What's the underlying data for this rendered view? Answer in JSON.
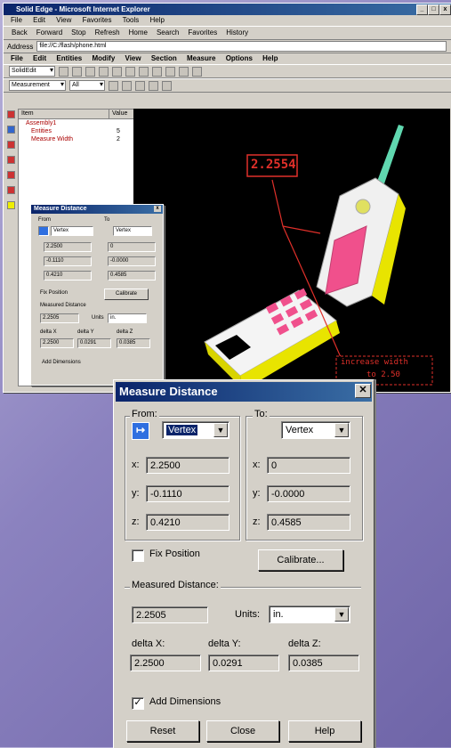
{
  "app": {
    "title": "Solid Edge - Microsoft Internet Explorer",
    "browser_menu": [
      "File",
      "Edit",
      "View",
      "Favorites",
      "Tools",
      "Help"
    ],
    "browser_toolbar": [
      "Back",
      "Forward",
      "Stop",
      "Refresh",
      "Home",
      "Search",
      "Favorites",
      "History"
    ],
    "address_label": "Address",
    "address_value": "file://C:/flash/phone.html",
    "app_menu": [
      "File",
      "Edit",
      "Entities",
      "Modify",
      "View",
      "Section",
      "Measure",
      "Options",
      "Help"
    ],
    "combo1": "SolidEdit",
    "combo2": "Measurement",
    "combo3": "All",
    "tree_headers": [
      "Item",
      "Value"
    ],
    "tree_items": [
      {
        "label": "Assembly1",
        "value": ""
      },
      {
        "label": "Entities",
        "value": "5"
      },
      {
        "label": "Measure Width",
        "value": "2"
      }
    ]
  },
  "viewport": {
    "measure_label": "2.2554",
    "callout_line1": "increase width",
    "callout_line2": "to 2.50"
  },
  "mini_dialog": {
    "title": "Measure Distance",
    "from": "From",
    "to": "To",
    "from_mode": "Vertex",
    "to_mode": "Vertex",
    "x_from": "2.2500",
    "y_from": "-0.1110",
    "z_from": "0.4210",
    "x_to": "0",
    "y_to": "-0.0000",
    "z_to": "0.4585",
    "fix": "Fix Position",
    "calibrate": "Calibrate",
    "measured": "Measured Distance",
    "distance": "2.2505",
    "units_label": "Units",
    "units": "in.",
    "dx_label": "delta X",
    "dy_label": "delta Y",
    "dz_label": "delta Z",
    "dx": "2.2500",
    "dy": "0.0291",
    "dz": "0.0385",
    "add_dim": "Add Dimensions"
  },
  "dialog": {
    "title": "Measure Distance",
    "close_glyph": "✕",
    "from_label": "From:",
    "to_label": "To:",
    "pick_glyph": "↦",
    "from_mode": "Vertex",
    "to_mode": "Vertex",
    "axis_x": "x:",
    "axis_y": "y:",
    "axis_z": "z:",
    "from_x": "2.2500",
    "from_y": "-0.1110",
    "from_z": "0.4210",
    "to_x": "0",
    "to_y": "-0.0000",
    "to_z": "0.4585",
    "fix_position": "Fix Position",
    "calibrate": "Calibrate...",
    "measured_label": "Measured Distance:",
    "measured_value": "2.2505",
    "units_label": "Units:",
    "units_value": "in.",
    "delta_x_label": "delta X:",
    "delta_y_label": "delta Y:",
    "delta_z_label": "delta Z:",
    "delta_x": "2.2500",
    "delta_y": "0.0291",
    "delta_z": "0.0385",
    "add_dimensions": "Add Dimensions",
    "add_dimensions_checked": true,
    "check_glyph": "✓",
    "reset": "Reset",
    "close": "Close",
    "help": "Help"
  },
  "colors": {
    "titlebar": "#0a246a",
    "measure_red": "#e0302a",
    "phone_pink": "#f0508c",
    "phone_yellow": "#e8e400",
    "antenna": "#60d8b0"
  }
}
